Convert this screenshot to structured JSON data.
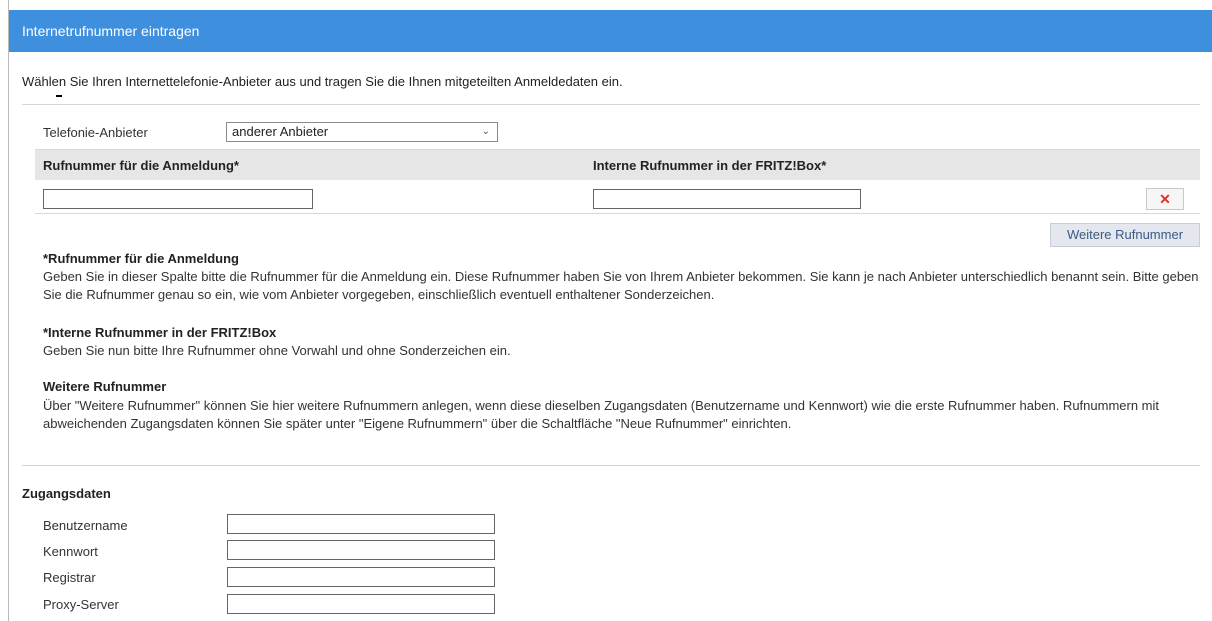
{
  "header": {
    "title": "Internetrufnummer eintragen"
  },
  "intro": {
    "text": "Wählen Sie Ihren Internettelefonie-Anbieter aus und tragen Sie die Ihnen mitgeteilten Anmeldedaten ein."
  },
  "provider": {
    "label": "Telefonie-Anbieter",
    "selected": "anderer Anbieter"
  },
  "numbers_table": {
    "col_login": "Rufnummer für die Anmeldung*",
    "col_internal": "Interne Rufnummer in der FRITZ!Box*",
    "row": {
      "login_value": "",
      "internal_value": ""
    },
    "delete_icon": "✕"
  },
  "more_button": "Weitere Rufnummer",
  "help": {
    "login_title": "*Rufnummer für die Anmeldung",
    "login_text": "Geben Sie in dieser Spalte bitte die Rufnummer für die Anmeldung ein. Diese Rufnummer haben Sie von Ihrem Anbieter bekommen. Sie kann je nach Anbieter unterschiedlich benannt sein. Bitte geben Sie die Rufnummer genau so ein, wie vom Anbieter vorgegeben, einschließlich eventuell enthaltener Sonderzeichen.",
    "internal_title": "*Interne Rufnummer in der FRITZ!Box",
    "internal_text": "Geben Sie nun bitte Ihre Rufnummer ohne Vorwahl und ohne Sonderzeichen ein.",
    "more_title": "Weitere Rufnummer",
    "more_text": "Über \"Weitere Rufnummer\" können Sie hier weitere Rufnummern anlegen, wenn diese dieselben Zugangsdaten (Benutzername und Kennwort) wie die erste Rufnummer haben. Rufnummern mit abweichenden Zugangsdaten können Sie später unter \"Eigene Rufnummern\" über die Schaltfläche \"Neue Rufnummer\" einrichten."
  },
  "credentials": {
    "title": "Zugangsdaten",
    "username_label": "Benutzername",
    "password_label": "Kennwort",
    "registrar_label": "Registrar",
    "proxy_label": "Proxy-Server",
    "username_value": "",
    "password_value": "",
    "registrar_value": "",
    "proxy_value": ""
  }
}
